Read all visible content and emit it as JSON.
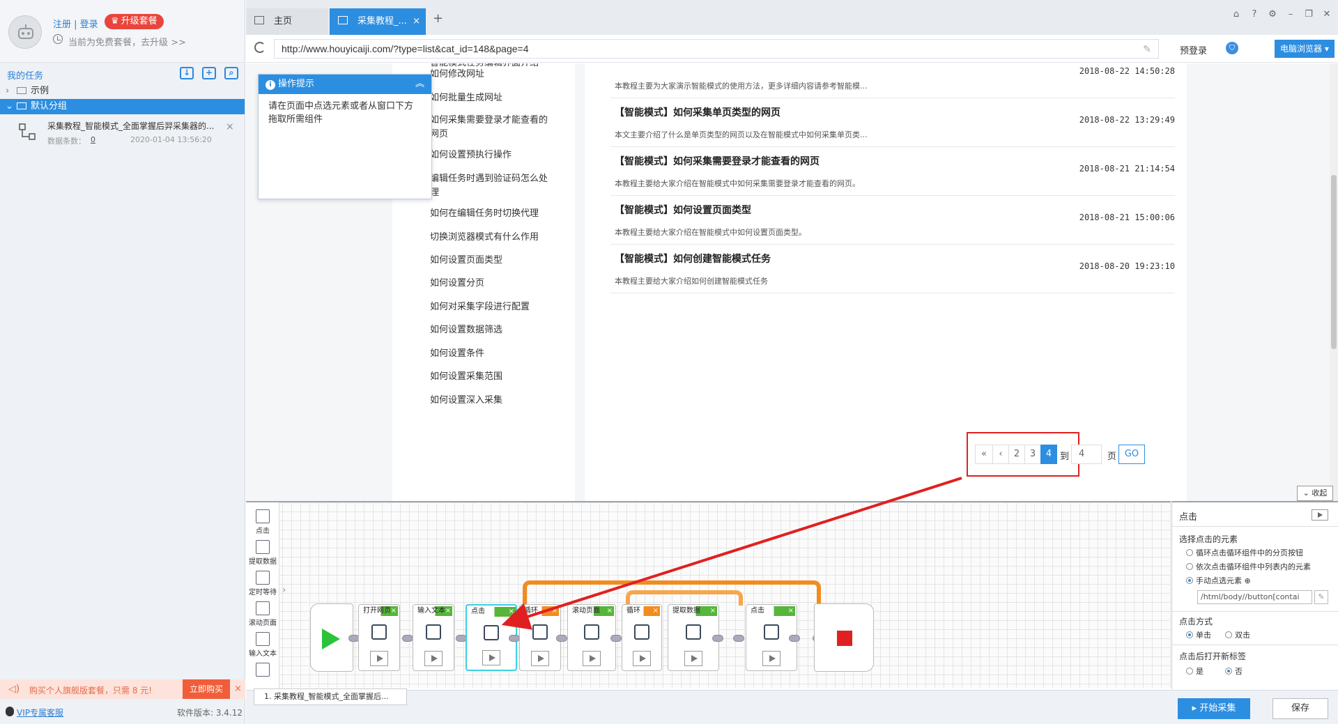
{
  "user": {
    "login_link": "注册 | 登录",
    "upgrade_label": "升级套餐",
    "plan_text": "当前为免费套餐，去升级 >>"
  },
  "tasks": {
    "title": "我的任务",
    "tree": [
      {
        "label": "示例",
        "expanded": false
      },
      {
        "label": "默认分组",
        "expanded": true
      }
    ],
    "item": {
      "name": "采集教程_智能模式_全面掌握后羿采集器的...",
      "count_label": "数据条数：",
      "count": "0",
      "date": "2020-01-04 13:56:20"
    }
  },
  "promo": {
    "text": "购买个人旗舰版套餐，只需 8 元!",
    "buy_label": "立即购买"
  },
  "footer": {
    "vip_link": "VIP专属客服",
    "version": "软件版本: 3.4.12"
  },
  "tabs": {
    "home_label": "主页",
    "active_label": "采集教程_..."
  },
  "address": {
    "url": "http://www.houyicaiji.com/?type=list&cat_id=148&page=4",
    "prelogin_label": "预登录",
    "browser_label": "电脑浏览器"
  },
  "tip": {
    "title": "操作提示",
    "body": "请在页面中点选元素或者从窗口下方拖取所需组件"
  },
  "toc": [
    "智能模式任务编辑界面介绍",
    "如何修改网址",
    "如何批量生成网址",
    "如何采集需要登录才能查看的网页",
    "如何设置预执行操作",
    "编辑任务时遇到验证码怎么处理",
    "如何在编辑任务时切换代理",
    "切换浏览器模式有什么作用",
    "如何设置页面类型",
    "如何设置分页",
    "如何对采集字段进行配置",
    "如何设置数据筛选",
    "如何设置条件",
    "如何设置采集范围",
    "如何设置深入采集"
  ],
  "articles": [
    {
      "title": "",
      "date": "2018-08-22 14:50:28",
      "desc": "本教程主要为大家演示智能模式的使用方法，更多详细内容请参考智能模..."
    },
    {
      "title": "【智能模式】如何采集单页类型的网页",
      "date": "2018-08-22 13:29:49",
      "desc": "本文主要介绍了什么是单页类型的网页以及在智能模式中如何采集单页类..."
    },
    {
      "title": "【智能模式】如何采集需要登录才能查看的网页",
      "date": "2018-08-21 21:14:54",
      "desc": "本教程主要给大家介绍在智能模式中如何采集需要登录才能查看的网页。"
    },
    {
      "title": "【智能模式】如何设置页面类型",
      "date": "2018-08-21 15:00:06",
      "desc": "本教程主要给大家介绍在智能模式中如何设置页面类型。"
    },
    {
      "title": "【智能模式】如何创建智能模式任务",
      "date": "2018-08-20 19:23:10",
      "desc": "本教程主要给大家介绍如何创建智能模式任务"
    }
  ],
  "pager": {
    "first": "«",
    "prev": "‹",
    "pages": [
      "2",
      "3",
      "4"
    ],
    "current": "4",
    "goto_label": "到",
    "goto_value": "4",
    "page_label": "页",
    "go_label": "GO"
  },
  "collapse_label": "收起",
  "tools": [
    "点击",
    "提取数据",
    "定时等待",
    "滚动页面",
    "输入文本"
  ],
  "workflow": {
    "nodes": [
      {
        "label": "打开网页",
        "color": "green"
      },
      {
        "label": "输入文本",
        "color": "green"
      },
      {
        "label": "点击",
        "color": "green"
      },
      {
        "label": "循环",
        "color": "orange"
      },
      {
        "label": "滚动页面",
        "color": "green"
      },
      {
        "label": "循环",
        "color": "orange"
      },
      {
        "label": "提取数据",
        "color": "green"
      },
      {
        "label": "点击",
        "color": "green"
      }
    ],
    "tab_label": "1. 采集教程_智能模式_全面掌握后..."
  },
  "props": {
    "title": "点击",
    "select_section": "选择点击的元素",
    "options": [
      "循环点击循环组件中的分页按钮",
      "依次点击循环组件中列表内的元素",
      "手动点选元素"
    ],
    "xpath": "/html/body//button[contai",
    "method_section": "点击方式",
    "method_options": [
      "单击",
      "双击"
    ],
    "newtab_section": "点击后打开新标签",
    "newtab_options": [
      "是",
      "否"
    ]
  },
  "actions": {
    "start_label": "开始采集",
    "save_label": "保存"
  },
  "colors": {
    "accent": "#2c8ee0",
    "danger": "#e02020",
    "green": "#56b63a",
    "orange": "#f28c1e"
  }
}
